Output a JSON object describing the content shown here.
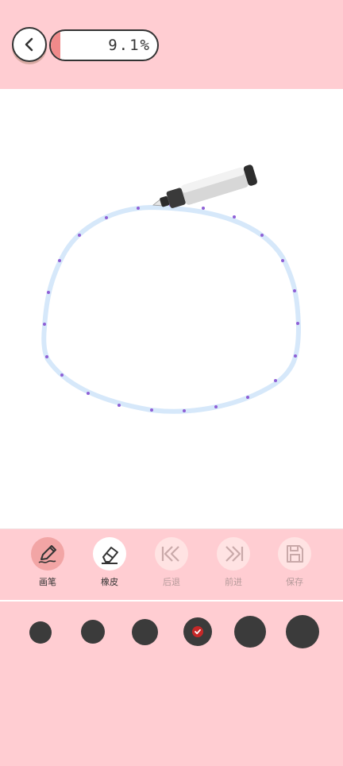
{
  "progress": {
    "text": "9.1%",
    "value": 0.091,
    "fill_color": "#f08a8a"
  },
  "tools": [
    {
      "label": "画笔",
      "icon": "pen-icon",
      "state": "active"
    },
    {
      "label": "橡皮",
      "icon": "eraser-icon",
      "state": "enabled"
    },
    {
      "label": "后退",
      "icon": "undo-icon",
      "state": "disabled"
    },
    {
      "label": "前进",
      "icon": "redo-icon",
      "state": "disabled"
    },
    {
      "label": "保存",
      "icon": "save-icon",
      "state": "disabled"
    }
  ],
  "brush_sizes": {
    "count": 6,
    "selected_index": 3,
    "color": "#3b3b3b",
    "check_color": "#c62828"
  },
  "colors": {
    "background": "#ffcdd2",
    "stroke": "#d6e8fa",
    "guide_dots": "#8e5fd6"
  }
}
